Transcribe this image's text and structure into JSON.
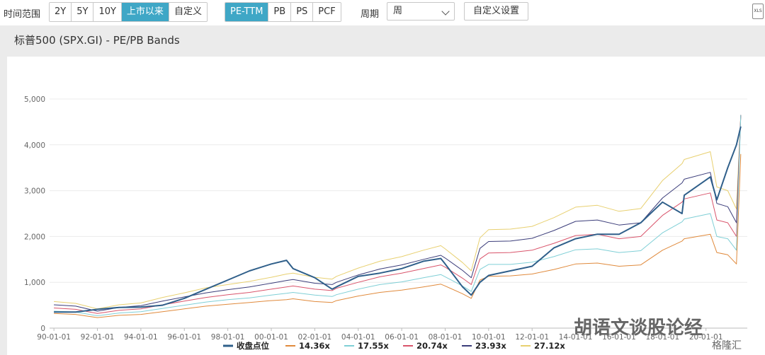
{
  "toolbar": {
    "range_label": "时间范围",
    "ranges": [
      "2Y",
      "5Y",
      "10Y",
      "上市以来",
      "自定义"
    ],
    "active_range": "上市以来",
    "metrics": [
      "PE-TTM",
      "PB",
      "PS",
      "PCF"
    ],
    "active_metric": "PE-TTM",
    "period_label": "周期",
    "period_value": "周",
    "custom_settings": "自定义设置",
    "export_icon_text": "XLS"
  },
  "panel": {
    "title": "标普500 (SPX.GI) - PE/PB Bands"
  },
  "watermark": {
    "text": "胡语文谈股论经",
    "logo_text": "格隆汇"
  },
  "colors": {
    "active_button": "#3fa7c6",
    "index": "#2f5f8a",
    "band_14": "#e08a3c",
    "band_17": "#7fcfd6",
    "band_20": "#d9546b",
    "band_23": "#3b3d7a",
    "band_27": "#e8d070"
  },
  "chart_data": {
    "type": "line",
    "y_ticks": [
      "5,000",
      "4,000",
      "3,000",
      "2,000",
      "1,000",
      "0"
    ],
    "ylim": [
      0,
      5000
    ],
    "x_ticks": [
      "90-01-01",
      "92-01-01",
      "94-01-01",
      "96-01-01",
      "98-01-01",
      "00-01-01",
      "02-01-01",
      "04-01-01",
      "06-01-01",
      "08-01-01",
      "10-01-01",
      "12-01-01",
      "14-01-01",
      "16-01-01",
      "18-01-01",
      "20-01-01"
    ],
    "x_years": [
      1990,
      1992,
      1994,
      1996,
      1998,
      2000,
      2002,
      2004,
      2006,
      2008,
      2010,
      2012,
      2014,
      2016,
      2018,
      2020
    ],
    "xlim": [
      1989.8,
      2021.9
    ],
    "grid": true,
    "legend_position": "bottom",
    "years": [
      1990,
      1991,
      1992,
      1993,
      1994,
      1995,
      1996,
      1997,
      1998,
      1999,
      2000,
      2000.7,
      2001,
      2002,
      2002.8,
      2003,
      2004,
      2005,
      2006,
      2007,
      2007.8,
      2008,
      2008.8,
      2009.2,
      2009.6,
      2010,
      2011,
      2012,
      2013,
      2014,
      2015,
      2016,
      2017,
      2018,
      2018.9,
      2019,
      2020.2,
      2020.5,
      2021,
      2021.4,
      2021.6
    ],
    "series": [
      {
        "name": "收盘点位",
        "values": [
          350,
          350,
          410,
          450,
          460,
          500,
          650,
          850,
          1050,
          1250,
          1400,
          1480,
          1300,
          1100,
          850,
          900,
          1130,
          1200,
          1300,
          1460,
          1520,
          1400,
          900,
          720,
          1000,
          1150,
          1250,
          1350,
          1750,
          1950,
          2050,
          2050,
          2300,
          2750,
          2500,
          2900,
          3300,
          2800,
          3500,
          4000,
          4400
        ]
      },
      {
        "name": "14.36x",
        "values": [
          320,
          300,
          230,
          280,
          300,
          360,
          420,
          480,
          520,
          560,
          600,
          620,
          640,
          580,
          560,
          600,
          700,
          780,
          830,
          900,
          960,
          920,
          750,
          650,
          1050,
          1130,
          1140,
          1180,
          1280,
          1400,
          1420,
          1350,
          1380,
          1700,
          1900,
          1950,
          2050,
          1650,
          1600,
          1400,
          3800
        ]
      },
      {
        "name": "17.55x",
        "values": [
          370,
          350,
          270,
          330,
          360,
          430,
          500,
          570,
          620,
          660,
          720,
          760,
          780,
          720,
          690,
          730,
          850,
          950,
          1010,
          1100,
          1170,
          1120,
          920,
          800,
          1280,
          1390,
          1390,
          1440,
          1560,
          1710,
          1730,
          1650,
          1690,
          2080,
          2320,
          2380,
          2500,
          2000,
          1950,
          1700,
          4650
        ]
      },
      {
        "name": "20.74x",
        "values": [
          440,
          410,
          320,
          390,
          420,
          510,
          590,
          670,
          730,
          780,
          850,
          900,
          920,
          850,
          820,
          870,
          1000,
          1120,
          1200,
          1300,
          1380,
          1330,
          1090,
          950,
          1510,
          1640,
          1650,
          1700,
          1850,
          2020,
          2050,
          1950,
          2000,
          2460,
          2750,
          2820,
          2950,
          2360,
          2300,
          2000,
          4650
        ]
      },
      {
        "name": "23.93x",
        "values": [
          510,
          480,
          370,
          450,
          490,
          590,
          680,
          770,
          840,
          900,
          980,
          1040,
          1060,
          980,
          950,
          1000,
          1160,
          1290,
          1380,
          1500,
          1590,
          1530,
          1260,
          1100,
          1740,
          1890,
          1900,
          1960,
          2130,
          2330,
          2360,
          2250,
          2300,
          2840,
          3170,
          3250,
          3400,
          2720,
          2650,
          2300,
          4650
        ]
      },
      {
        "name": "27.12x",
        "values": [
          580,
          540,
          420,
          510,
          550,
          670,
          770,
          880,
          950,
          1020,
          1110,
          1180,
          1200,
          1110,
          1070,
          1130,
          1310,
          1460,
          1560,
          1700,
          1800,
          1730,
          1430,
          1250,
          1970,
          2150,
          2160,
          2220,
          2410,
          2640,
          2680,
          2550,
          2610,
          3220,
          3590,
          3680,
          3850,
          3080,
          3000,
          2600,
          4650
        ]
      }
    ]
  }
}
